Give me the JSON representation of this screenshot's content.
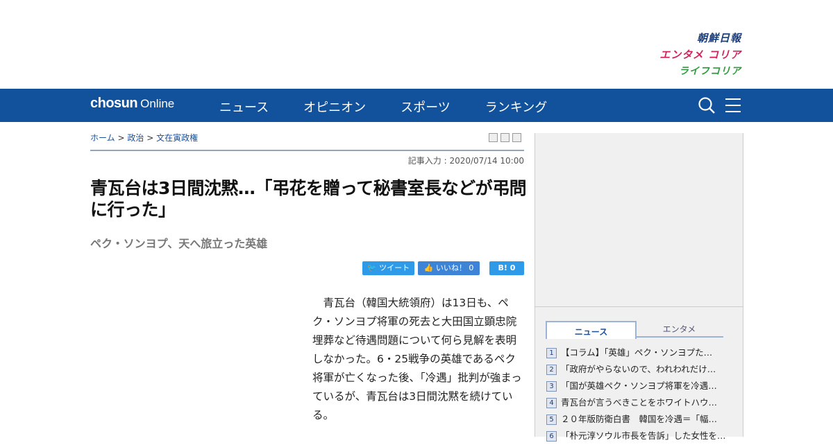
{
  "brands": {
    "chosun": "朝鮮日報",
    "entame": "エンタメ コリア",
    "life": "ライフコリア"
  },
  "nav": {
    "logo_bold": "chosun",
    "logo_light": "Online",
    "links": [
      "ニュース",
      "オピニオン",
      "スポーツ",
      "ランキング"
    ]
  },
  "breadcrumb": {
    "home": "ホーム",
    "sep": ">",
    "section": "政治",
    "topic": "文在寅政権"
  },
  "article": {
    "date": "記事入力 : 2020/07/14 10:00",
    "headline": "青瓦台は3日間沈黙…「弔花を贈って秘書室長などが弔問に行った」",
    "subtitle": "ペク・ソンヨプ、天へ旅立った英雄",
    "body": "青瓦台（韓国大統領府）は13日も、ペク・ソンヨプ将軍の死去と大田国立顕忠院埋葬など待遇問題について何ら見解を表明しなかった。6・25戦争の英雄であるペク将軍が亡くなった後、「冷遇」批判が強まっているが、青瓦台は3日間沈黙を続けている。"
  },
  "share": {
    "tweet": "ツイート",
    "like": "いいね！ 0",
    "hatena": "B! 0"
  },
  "sidebar": {
    "tabs": [
      "ニュース",
      "エンタメ"
    ],
    "ranking": [
      {
        "num": "1",
        "title": "【コラム】「英雄」ペク・ソンヨプた…"
      },
      {
        "num": "2",
        "title": "「政府がやらないので、われわれだけ…"
      },
      {
        "num": "3",
        "title": "「国が英雄ペク・ソンヨプ将軍を冷遇…"
      },
      {
        "num": "4",
        "title": "青瓦台が言うべきことをホワイトハウ…"
      },
      {
        "num": "5",
        "title": "２０年版防衛白書　韓国を冷遇＝「幅…"
      },
      {
        "num": "6",
        "title": "「朴元淳ソウル市長を告訴」した女性を…"
      }
    ]
  },
  "colors": {
    "nav": "#12519c",
    "accent_link": "#1a4f9a",
    "twitter": "#2f9ae8",
    "facebook": "#3d84d6"
  }
}
